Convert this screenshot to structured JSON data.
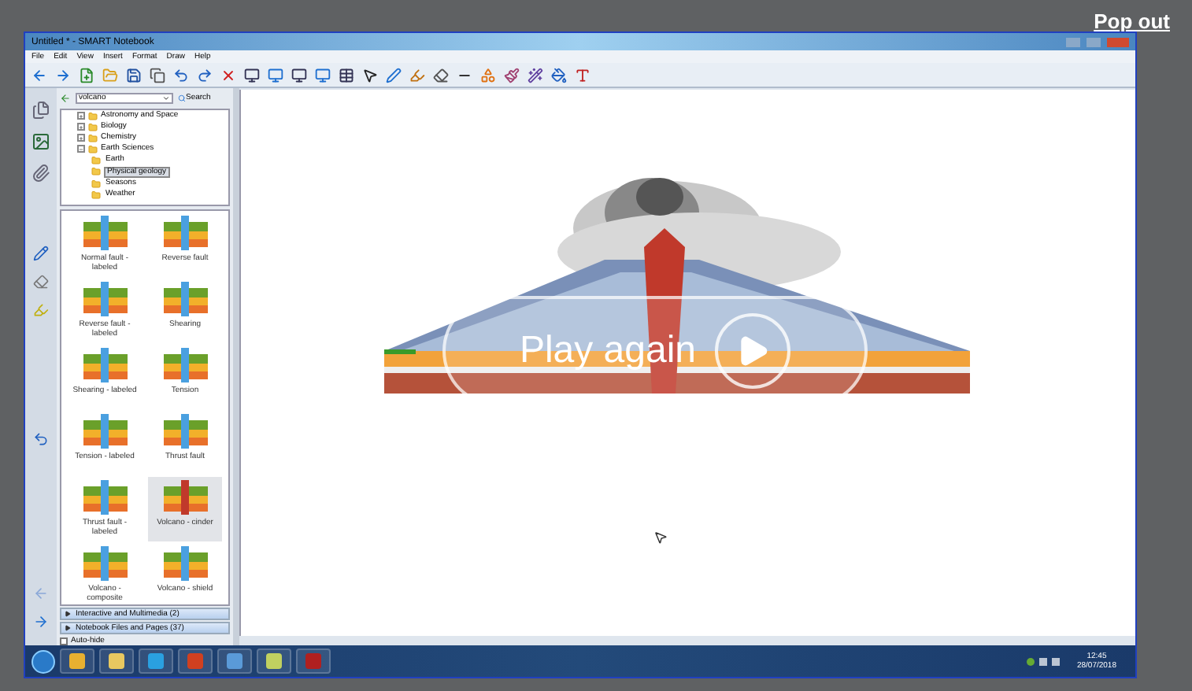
{
  "player": {
    "pop_out": "Pop out",
    "play_again": "Play again"
  },
  "window": {
    "title": "Untitled * - SMART Notebook"
  },
  "menu": [
    "File",
    "Edit",
    "View",
    "Insert",
    "Format",
    "Draw",
    "Help"
  ],
  "gallery": {
    "search": {
      "value": "volcano",
      "button": "Search"
    },
    "tree": [
      {
        "label": "Astronomy and Space",
        "expanded": false,
        "selected": false
      },
      {
        "label": "Biology",
        "expanded": false,
        "selected": false
      },
      {
        "label": "Chemistry",
        "expanded": false,
        "selected": false
      },
      {
        "label": "Earth Sciences",
        "expanded": true,
        "selected": false,
        "children": [
          {
            "label": "Earth",
            "selected": false
          },
          {
            "label": "Physical geology",
            "selected": true
          },
          {
            "label": "Seasons",
            "selected": false
          },
          {
            "label": "Weather",
            "selected": false
          }
        ]
      }
    ],
    "items": [
      {
        "label": "Normal fault - labeled",
        "selected": false
      },
      {
        "label": "Reverse fault",
        "selected": false
      },
      {
        "label": "Reverse fault - labeled",
        "selected": false
      },
      {
        "label": "Shearing",
        "selected": false
      },
      {
        "label": "Shearing - labeled",
        "selected": false
      },
      {
        "label": "Tension",
        "selected": false
      },
      {
        "label": "Tension - labeled",
        "selected": false
      },
      {
        "label": "Thrust fault",
        "selected": false
      },
      {
        "label": "Thrust fault - labeled",
        "selected": false
      },
      {
        "label": "Volcano - cinder",
        "selected": true
      },
      {
        "label": "Volcano - composite",
        "selected": false
      },
      {
        "label": "Volcano - shield",
        "selected": false
      }
    ],
    "sections": [
      "Interactive and Multimedia (2)",
      "Notebook Files and Pages (37)"
    ],
    "auto_hide": {
      "label": "Auto-hide",
      "checked": false
    }
  },
  "tray": {
    "time": "12:45",
    "date": "28/07/2018"
  }
}
